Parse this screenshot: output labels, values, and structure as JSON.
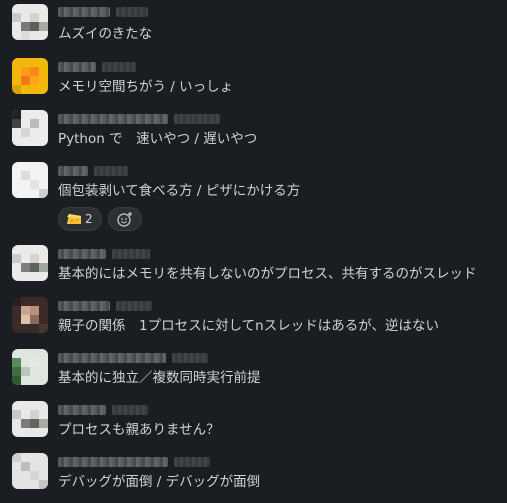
{
  "messages": [
    {
      "text": "ムズイのきたな"
    },
    {
      "text": "メモリ空間ちがう / いっしょ"
    },
    {
      "text": "Python で　速いやつ / 遅いやつ"
    },
    {
      "text": "個包装剥いて食べる方 / ピザにかける方",
      "reactions": [
        {
          "icon": "cheese-emoji-icon",
          "count": "2"
        }
      ],
      "add_reaction_icon": "add-emoji-icon"
    },
    {
      "text": "基本的にはメモリを共有しないのがプロセス、共有するのがスレッド"
    },
    {
      "text": "親子の関係　1プロセスに対してnスレッドはあるが、逆はない"
    },
    {
      "text": "基本的に独立／複数同時実行前提"
    },
    {
      "text": "プロセスも親ありません？"
    },
    {
      "text": "デバッグが面倒 / デバッグが面倒"
    }
  ],
  "colors": {
    "background": "#1a1d21",
    "text": "#d1d2d3",
    "reaction_bg": "#2c2f33"
  }
}
